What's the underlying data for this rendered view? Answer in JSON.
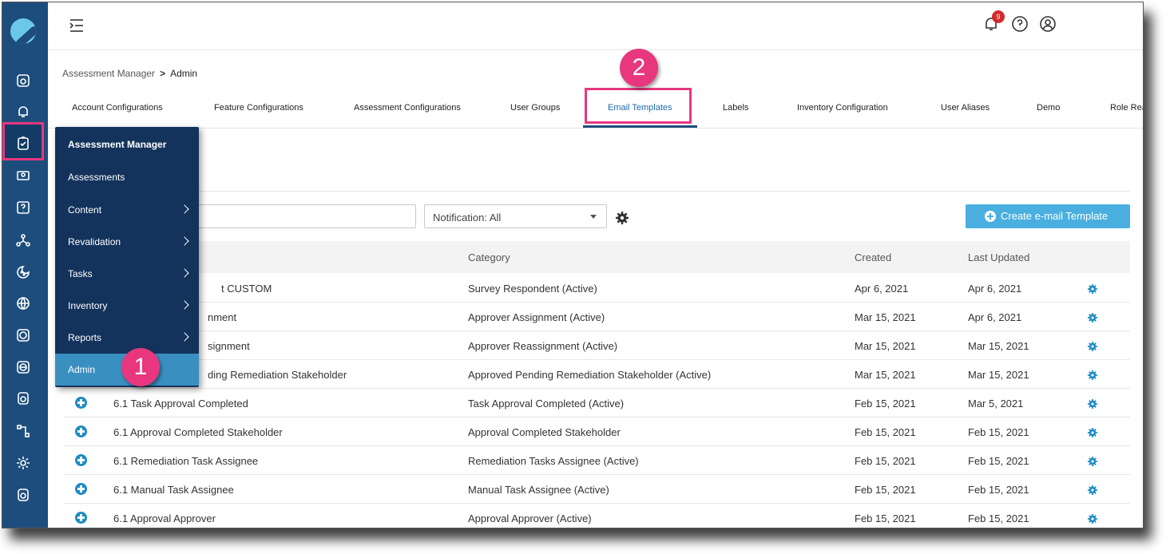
{
  "header": {
    "notification_count": "9"
  },
  "breadcrumb": {
    "parent": "Assessment Manager",
    "separator": ">",
    "current": "Admin"
  },
  "tabs": [
    {
      "label": "Account Configurations"
    },
    {
      "label": "Feature Configurations"
    },
    {
      "label": "Assessment Configurations"
    },
    {
      "label": "User Groups"
    },
    {
      "label": "Email Templates",
      "active": true
    },
    {
      "label": "Labels"
    },
    {
      "label": "Inventory Configuration"
    },
    {
      "label": "User Aliases"
    },
    {
      "label": "Demo"
    },
    {
      "label": "Role Rea"
    }
  ],
  "callouts": {
    "one": "1",
    "two": "2"
  },
  "filters": {
    "notification_select": "Notification: All"
  },
  "create_button": {
    "label": "Create e-mail Template",
    "color": "#4aafdf"
  },
  "table": {
    "headers": [
      "Category",
      "Created",
      "Last Updated"
    ],
    "rows": [
      {
        "name": "t CUSTOM",
        "category": "Survey Respondent (Active)",
        "created": "Apr 6, 2021",
        "updated": "Apr 6, 2021"
      },
      {
        "name": "nment",
        "category": "Approver Assignment (Active)",
        "created": "Mar 15, 2021",
        "updated": "Apr 6, 2021"
      },
      {
        "name": "signment",
        "category": "Approver Reassignment (Active)",
        "created": "Mar 15, 2021",
        "updated": "Mar 15, 2021"
      },
      {
        "name": "ding Remediation Stakeholder",
        "category": "Approved Pending Remediation Stakeholder (Active)",
        "created": "Mar 15, 2021",
        "updated": "Mar 15, 2021"
      },
      {
        "name": "6.1 Task Approval Completed",
        "category": "Task Approval Completed (Active)",
        "created": "Feb 15, 2021",
        "updated": "Mar 5, 2021"
      },
      {
        "name": "6.1 Approval Completed Stakeholder",
        "category": "Approval Completed Stakeholder",
        "created": "Feb 15, 2021",
        "updated": "Feb 15, 2021"
      },
      {
        "name": "6.1 Remediation Task Assignee",
        "category": "Remediation Tasks Assignee (Active)",
        "created": "Feb 15, 2021",
        "updated": "Feb 15, 2021"
      },
      {
        "name": "6.1 Manual Task Assignee",
        "category": "Manual Task Assignee (Active)",
        "created": "Feb 15, 2021",
        "updated": "Feb 15, 2021"
      },
      {
        "name": "6.1 Approval Approver",
        "category": "Approval Approver (Active)",
        "created": "Feb 15, 2021",
        "updated": "Feb 15, 2021"
      }
    ]
  },
  "flyout": {
    "title": "Assessment Manager",
    "items": [
      {
        "label": "Assessments"
      },
      {
        "label": "Content"
      },
      {
        "label": "Revalidation"
      },
      {
        "label": "Tasks"
      },
      {
        "label": "Inventory"
      },
      {
        "label": "Reports"
      },
      {
        "label": "Admin"
      }
    ]
  },
  "colors": {
    "rail": "#1d4d7c",
    "flyout": "#13335c",
    "highlight": "#e8377f",
    "active_item": "#3a8fc1"
  }
}
